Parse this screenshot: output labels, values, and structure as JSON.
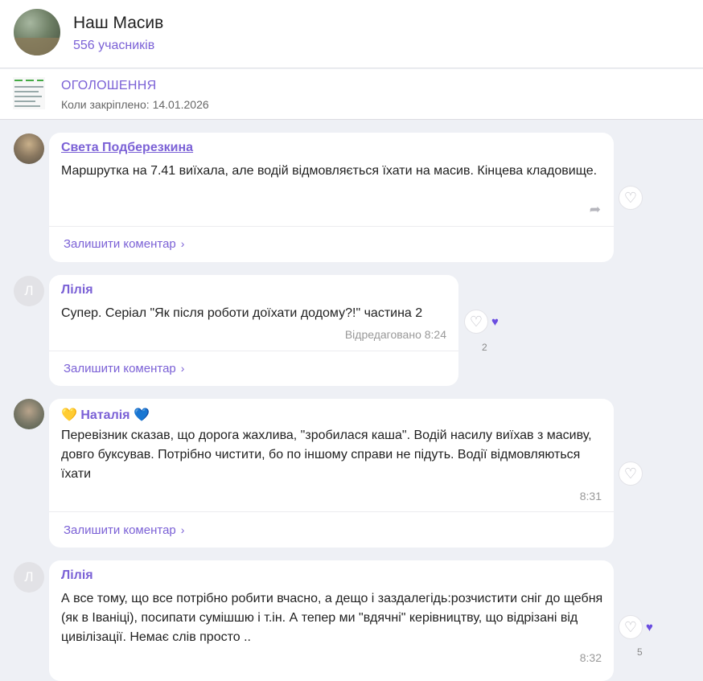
{
  "group": {
    "title": "Наш Масив",
    "members": "556 учасників"
  },
  "pinned": {
    "title": "ОГОЛОШЕННЯ",
    "date": "Коли закріплено: 14.01.2026"
  },
  "comment_label": "Залишити коментар",
  "messages": [
    {
      "author": "Света Подберезкина",
      "text": "Маршрутка на 7.41 виїхала, але водій відмовляється їхати на масив. Кінцева кладовище.",
      "time": ""
    },
    {
      "author": "Лілія",
      "avatar_letter": "Л",
      "text": "Супер. Серіал \"Як після роботи доїхати додому?!\" частина 2",
      "time": "Відредаговано 8:24",
      "likes": "2"
    },
    {
      "author": "Наталія",
      "emoji_left": "💛",
      "emoji_right": "💙",
      "text": "Перевізник сказав, що дорога жахлива, \"зробилася  каша\". Водій насилу виїхав з масиву, довго буксував. Потрібно чистити, бо по іншому справи не підуть. Водії відмовляються їхати",
      "time": "8:31"
    },
    {
      "author": "Лілія",
      "avatar_letter": "Л",
      "text": "А все тому, що все потрібно робити вчасно, а дещо і заздалегідь:розчистити сніг до щебня (як в Іваніці), посипати сумішшю і т.ін. А тепер ми \"вдячні\" керівництву, що відрізані від цивілізації. Немає слів просто ..",
      "time": "8:32",
      "likes": "5"
    }
  ],
  "colors": {
    "accent": "#7b61d6",
    "background": "#eef0f5"
  }
}
